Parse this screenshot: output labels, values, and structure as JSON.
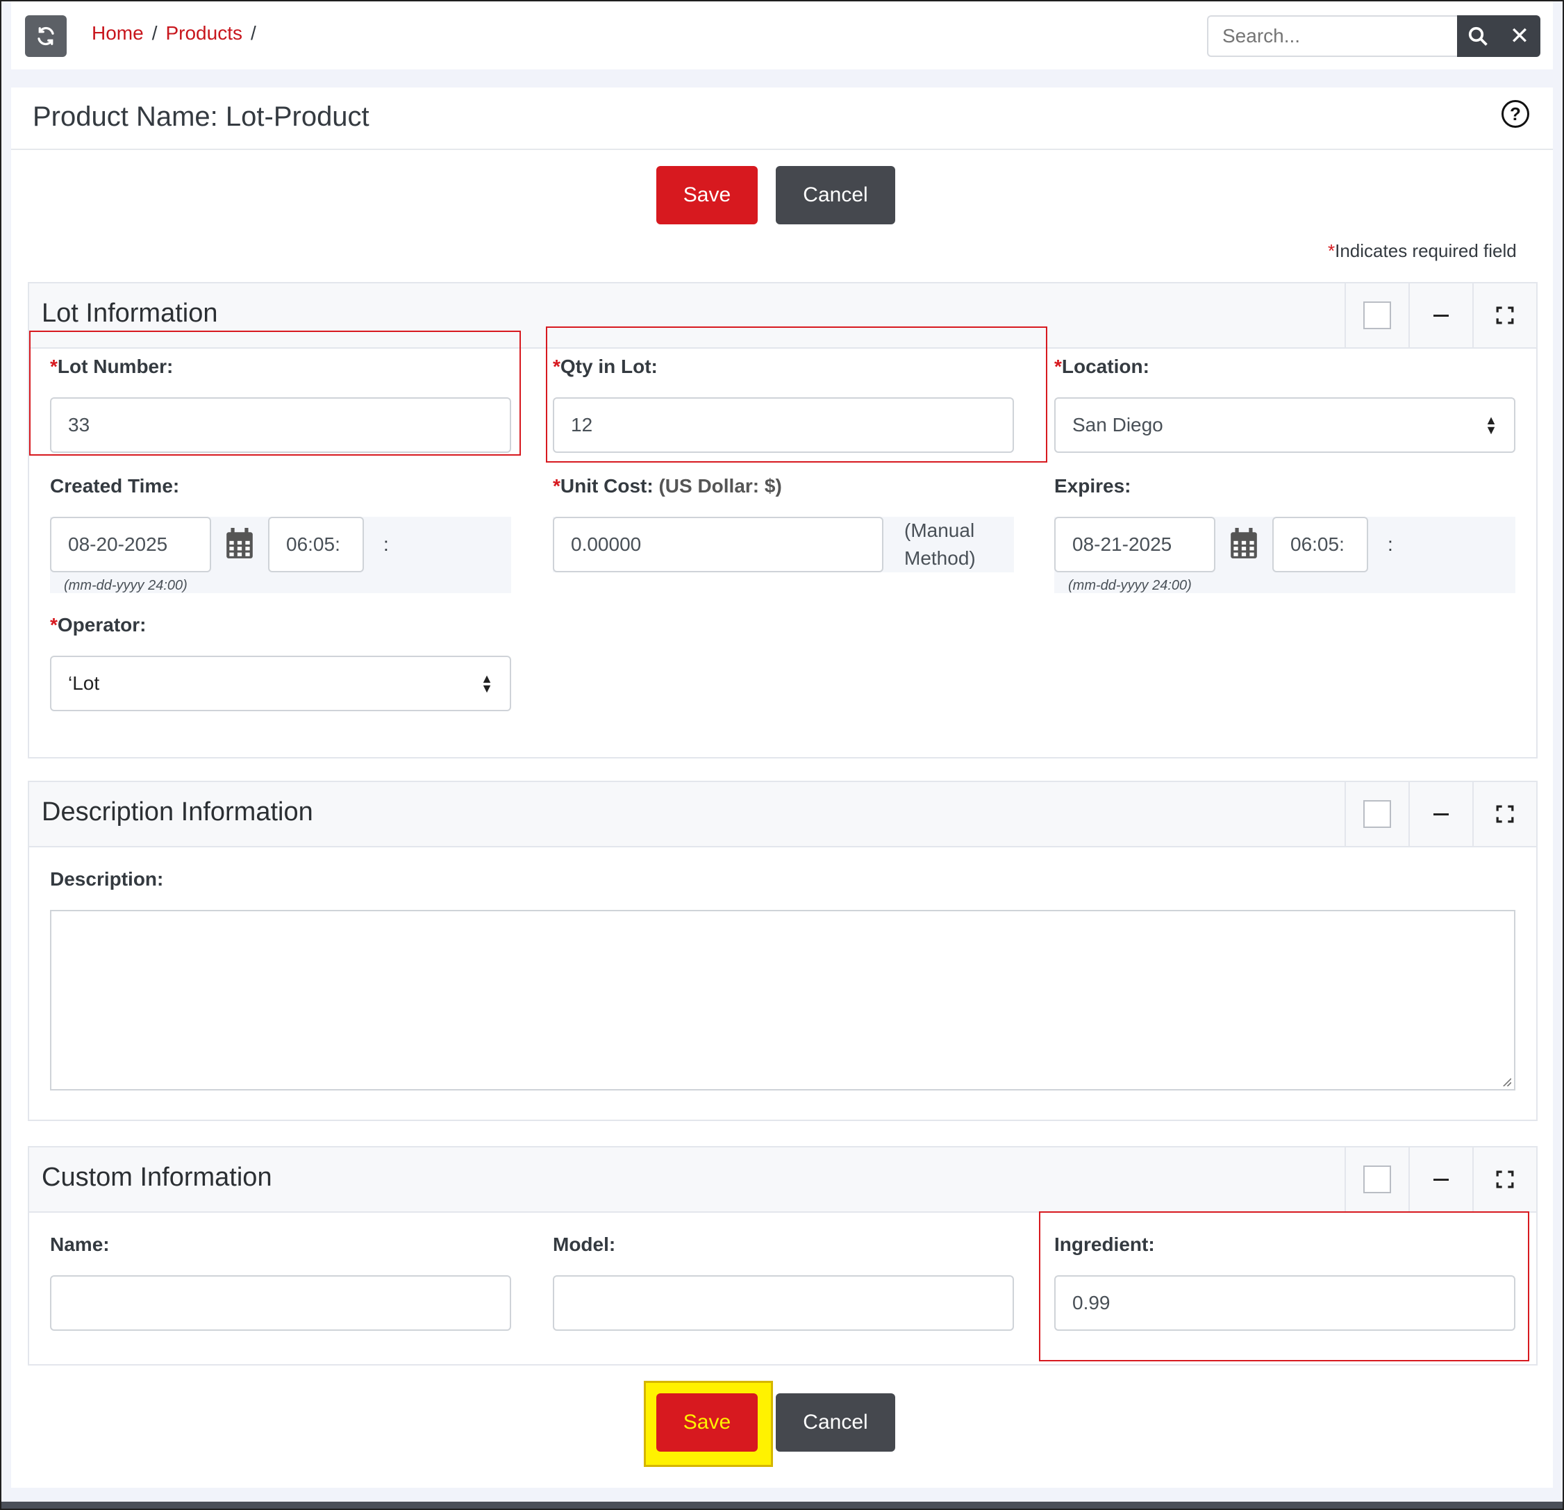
{
  "breadcrumb": {
    "home": "Home",
    "products": "Products",
    "separator": "/"
  },
  "search": {
    "placeholder": "Search..."
  },
  "page": {
    "title": "Product Name: Lot-Product",
    "required_note": "Indicates required field",
    "required_mark": "*"
  },
  "actions": {
    "save": "Save",
    "cancel": "Cancel"
  },
  "lot_panel": {
    "title": "Lot Information",
    "lot_number_label": "Lot Number:",
    "lot_number_value": "33",
    "qty_label": "Qty in Lot:",
    "qty_value": "12",
    "location_label": "Location:",
    "location_value": "San Diego",
    "created_label": "Created Time:",
    "created_date": "08-20-2025",
    "created_time": "06:05:",
    "date_hint": "(mm-dd-yyyy 24:00)",
    "colon": ":",
    "unit_cost_label": "Unit Cost:",
    "unit_cost_currency": "(US Dollar: $)",
    "unit_cost_value": "0.00000",
    "unit_cost_method_1": "(Manual",
    "unit_cost_method_2": "Method)",
    "expires_label": "Expires:",
    "expires_date": "08-21-2025",
    "expires_time": "06:05:",
    "operator_label": "Operator:",
    "operator_value": "‘Lot"
  },
  "description_panel": {
    "title": "Description Information",
    "description_label": "Description:",
    "description_value": ""
  },
  "custom_panel": {
    "title": "Custom Information",
    "name_label": "Name:",
    "name_value": "",
    "model_label": "Model:",
    "model_value": "",
    "ingredient_label": "Ingredient:",
    "ingredient_value": "0.99"
  },
  "icons": [
    "refresh-icon",
    "search-icon",
    "close-icon",
    "help-icon",
    "calendar-icon",
    "select-arrows-icon",
    "minimize-icon",
    "fullscreen-icon"
  ],
  "colors": {
    "accent": "#d7191f",
    "dark_button": "#45484e",
    "highlight": "#fff200"
  }
}
